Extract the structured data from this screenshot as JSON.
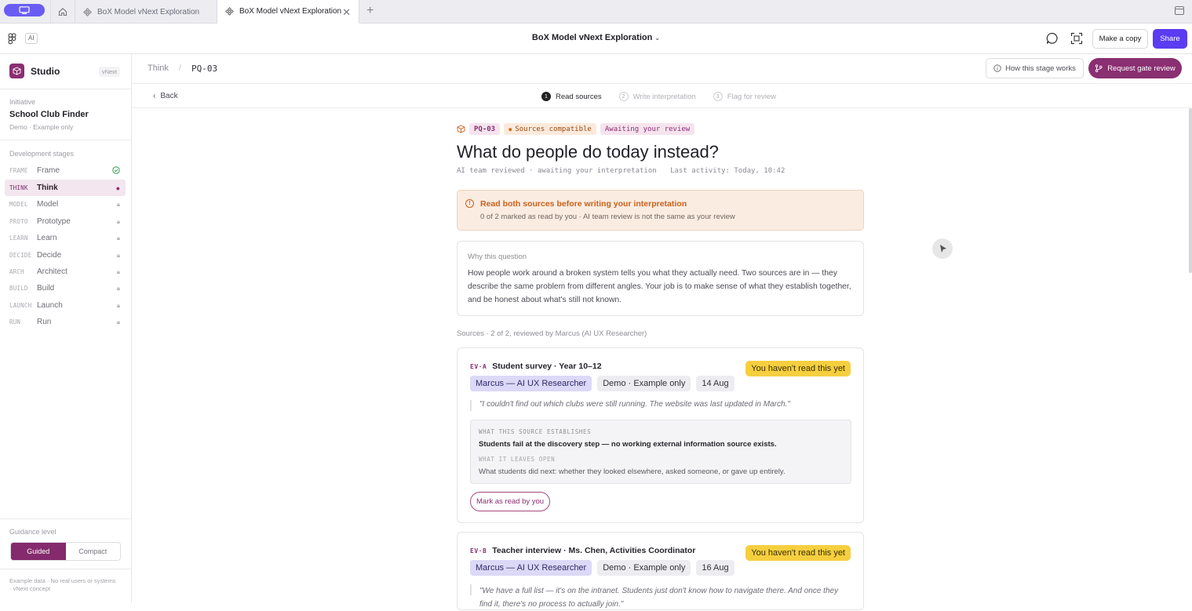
{
  "tabs": [
    {
      "label": "BoX Model vNext Exploration",
      "active": false
    },
    {
      "label": "BoX Model vNext Exploration",
      "active": true
    }
  ],
  "toolbar": {
    "ai_badge": "AI",
    "title": "BoX Model vNext Exploration",
    "copy_label": "Make a copy",
    "share_label": "Share"
  },
  "sidebar": {
    "brand": "Studio",
    "brand_tag": "vNext",
    "initiative_label": "Initiative",
    "initiative_name": "School Club Finder",
    "initiative_note": "Demo · Example only",
    "stages_label": "Development stages",
    "stages": [
      {
        "code": "FRAME",
        "name": "Frame",
        "status": "done"
      },
      {
        "code": "THINK",
        "name": "Think",
        "status": "current"
      },
      {
        "code": "MODEL",
        "name": "Model",
        "status": "locked"
      },
      {
        "code": "PROTO",
        "name": "Prototype",
        "status": "locked"
      },
      {
        "code": "LEARN",
        "name": "Learn",
        "status": "locked"
      },
      {
        "code": "DECIDE",
        "name": "Decide",
        "status": "locked"
      },
      {
        "code": "ARCH",
        "name": "Architect",
        "status": "locked"
      },
      {
        "code": "BUILD",
        "name": "Build",
        "status": "locked"
      },
      {
        "code": "LAUNCH",
        "name": "Launch",
        "status": "locked"
      },
      {
        "code": "RUN",
        "name": "Run",
        "status": "locked"
      }
    ],
    "guidance_label": "Guidance level",
    "guided": "Guided",
    "compact": "Compact",
    "footnote1": "Example data · No real users or systems",
    "footnote2": "· vNext concept"
  },
  "header": {
    "crumb_parent": "Think",
    "crumb_sep": "/",
    "crumb_current": "PQ-03",
    "how_label": "How this stage works",
    "gate_label": "Request gate review",
    "back_label": "Back",
    "steps": [
      {
        "n": "1",
        "label": "Read sources"
      },
      {
        "n": "2",
        "label": "Write interpretation"
      },
      {
        "n": "3",
        "label": "Flag for review"
      }
    ]
  },
  "question": {
    "code": "PQ-03",
    "compat": "Sources compatible",
    "awaiting": "Awaiting your review",
    "title": "What do people do today instead?",
    "meta1": "AI team reviewed · awaiting your interpretation",
    "meta2": "Last activity: Today, 10:42"
  },
  "alert": {
    "title": "Read both sources before writing your interpretation",
    "subtitle": "0 of 2 marked as read by you · AI team review is not the same as your review"
  },
  "why": {
    "title": "Why this question",
    "body": "How people work around a broken system tells you what they actually need. Two sources are in — they describe the same problem from different angles. Your job is to make sense of what they establish together, and be honest about what's still not known."
  },
  "sources_label": "Sources · 2 of 2, reviewed by Marcus (AI UX Researcher)",
  "sources": [
    {
      "code": "EV·A",
      "title": "Student survey · Year 10–12",
      "status": "You haven't read this yet",
      "reviewer": "Marcus — AI UX Researcher",
      "demo": "Demo · Example only",
      "date": "14 Aug",
      "quote": "\"I couldn't find out which clubs were still running. The website was last updated in March.\"",
      "est_label": "WHAT THIS SOURCE ESTABLISHES",
      "est_value": "Students fail at the discovery step — no working external information source exists.",
      "open_label": "WHAT IT LEAVES OPEN",
      "open_value": "What students did next: whether they looked elsewhere, asked someone, or gave up entirely.",
      "mark_label": "Mark as read by you"
    },
    {
      "code": "EV·B",
      "title": "Teacher interview · Ms. Chen, Activities Coordinator",
      "status": "You haven't read this yet",
      "reviewer": "Marcus — AI UX Researcher",
      "demo": "Demo · Example only",
      "date": "16 Aug",
      "quote": "\"We have a full list — it's on the intranet. Students just don't know how to navigate there. And once they find it, there's no process to actually join.\""
    }
  ],
  "colors": {
    "accent": "#8a2f72",
    "share": "#5b3cf0",
    "warn": "#c8611b",
    "badge": "#f6cf3f"
  }
}
